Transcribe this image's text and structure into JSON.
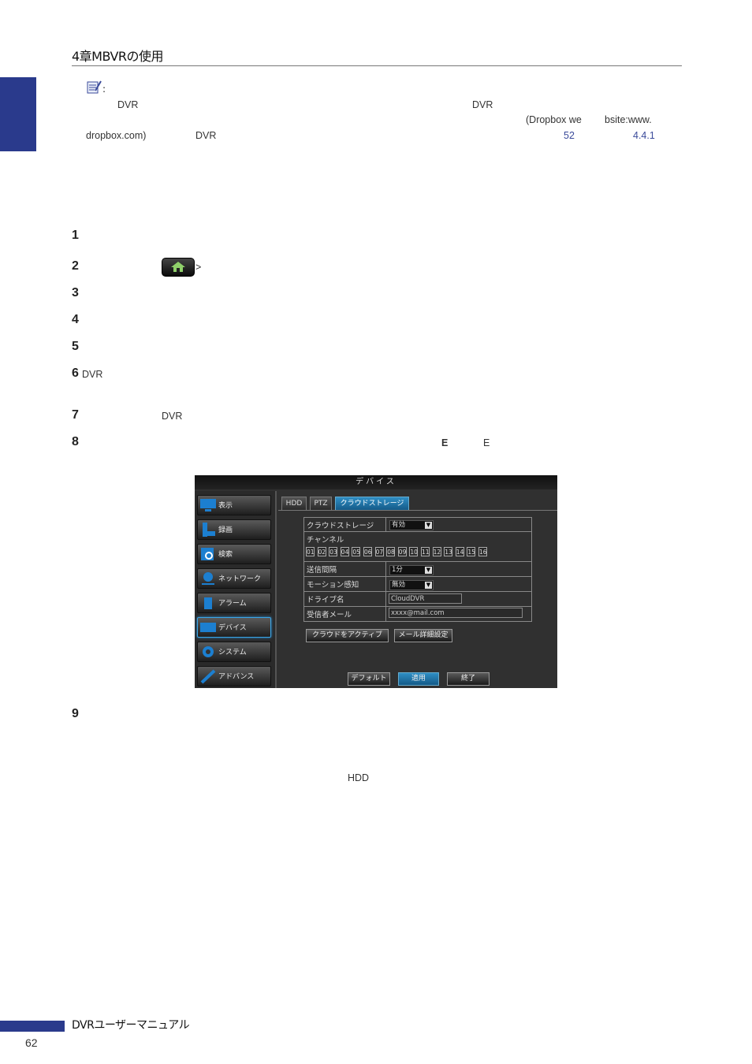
{
  "header": {
    "chapter_title": "4章MBVRの使用"
  },
  "note": {
    "colon": ":",
    "line1_a": "DVR",
    "line1_b": "DVR",
    "line2_a": "(Dropbox we",
    "line2_b": "bsite:www.",
    "line3_a": "dropbox.com)",
    "line3_b": "DVR",
    "link_page": "52",
    "link_section": "4.4.1"
  },
  "steps": {
    "s1": "1",
    "s2": "2",
    "s2_arrow": ">",
    "s3": "3",
    "s4": "4",
    "s5": "5",
    "s6": "6",
    "s6_text": "DVR",
    "s7": "7",
    "s7_text": "DVR",
    "s8": "8",
    "s8_bold": "E",
    "s8_text": "E",
    "s9": "9",
    "hdd": "HDD"
  },
  "dvr": {
    "title": "デバイス",
    "menu": [
      "表示",
      "録画",
      "検索",
      "ネットワーク",
      "アラーム",
      "デバイス",
      "システム",
      "アドバンス"
    ],
    "tabs": [
      "HDD",
      "PTZ",
      "クラウドストレージ"
    ],
    "rows": {
      "cloud_label": "クラウドストレージ",
      "cloud_value": "有効",
      "channel_label": "チャンネル",
      "channels": [
        "01",
        "02",
        "03",
        "04",
        "05",
        "06",
        "07",
        "08",
        "09",
        "10",
        "11",
        "12",
        "13",
        "14",
        "15",
        "16"
      ],
      "interval_label": "送信間隔",
      "interval_value": "1分",
      "motion_label": "モーション感知",
      "motion_value": "無効",
      "drive_label": "ドライブ名",
      "drive_value": "CloudDVR",
      "email_label": "受信者メール",
      "email_value": "xxxx@mail.com"
    },
    "activate_button": "クラウドをアクティブ",
    "mail_button": "メール詳細設定",
    "default_button": "デフォルト",
    "apply_button": "適用",
    "exit_button": "終了"
  },
  "footer": {
    "title": "DVRユーザーマニュアル",
    "page": "62"
  },
  "colors": {
    "accent": "#2a3a8c",
    "dvr_highlight": "#2f8ec4"
  }
}
